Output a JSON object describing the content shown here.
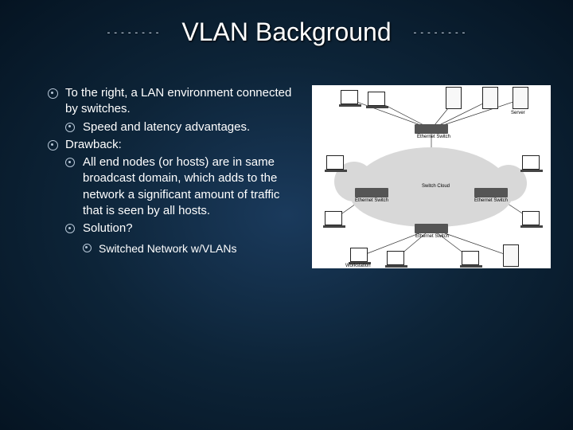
{
  "title": "VLAN Background",
  "decor_dashes": "- - - - - - - -",
  "bullets": {
    "item1": "To the right, a LAN environment connected by switches.",
    "item1_sub1": "Speed and latency advantages.",
    "item2": "Drawback:",
    "item2_sub1": "All end nodes (or hosts) are in same broadcast domain, which adds to the network a significant amount of traffic that is seen by all hosts.",
    "item2_sub2": "Solution?",
    "item2_sub2_sub1": "Switched Network w/VLANs"
  },
  "diagram": {
    "labels": {
      "top_switch": "Ethernet Switch",
      "left_switch": "Ethernet Switch",
      "right_switch": "Ethernet Switch",
      "bottom_switch": "Ethernet Switch",
      "center": "Switch Cloud",
      "workstation": "Workstation",
      "server1": "Server",
      "server2": "Server"
    }
  }
}
